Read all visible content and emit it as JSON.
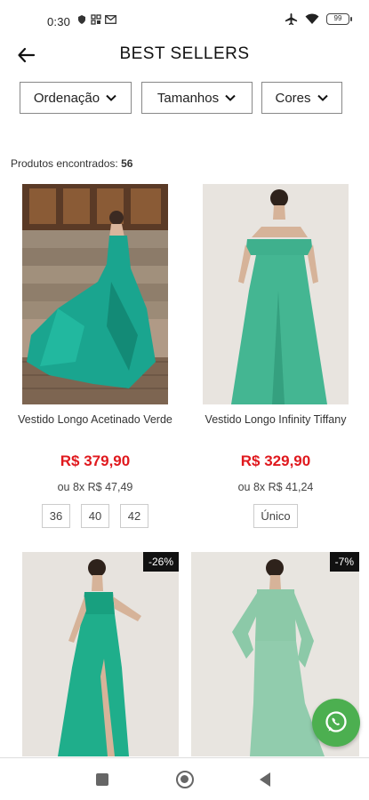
{
  "status_bar": {
    "time": "0:30",
    "battery": "99"
  },
  "header": {
    "title": "BEST SELLERS"
  },
  "filters": [
    {
      "label": "Ordenação"
    },
    {
      "label": "Tamanhos"
    },
    {
      "label": "Cores"
    }
  ],
  "results": {
    "label": "Produtos encontrados:",
    "count": "56"
  },
  "products": [
    {
      "name": "Vestido Longo Acetinado Verde",
      "price": "R$ 379,90",
      "installment": "ou 8x R$ 47,49",
      "sizes": [
        "36",
        "40",
        "42"
      ]
    },
    {
      "name": "Vestido Longo Infinity Tiffany",
      "price": "R$ 329,90",
      "installment": "ou 8x R$ 41,24",
      "sizes": [
        "Único"
      ]
    },
    {
      "discount": "-26%"
    },
    {
      "discount": "-7%"
    }
  ],
  "colors": {
    "price": "#e0191e",
    "whatsapp": "#4caf50",
    "dress_teal": "#1aa58f",
    "dress_mint": "#8cc9a8"
  }
}
